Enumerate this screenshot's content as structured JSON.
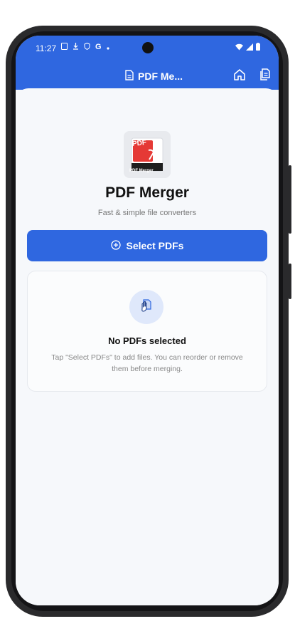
{
  "status": {
    "time": "11:27",
    "left_icons": [
      "sim-icon",
      "download-icon",
      "shield-icon",
      "google-icon",
      "dot-icon"
    ],
    "right_icons": [
      "wifi-icon",
      "signal-icon",
      "battery-icon"
    ]
  },
  "appbar": {
    "title": "PDF Me...",
    "title_icon": "document-icon",
    "actions": [
      "home-icon",
      "files-icon"
    ]
  },
  "hero": {
    "logo_top_text": "PDF",
    "logo_bottom_text": "PDF Merger",
    "app_name": "PDF Merger",
    "tagline": "Fast & simple file converters"
  },
  "select_button": {
    "label": "Select PDFs",
    "icon": "plus-circle-icon"
  },
  "empty_state": {
    "icon": "hand-document-icon",
    "title": "No PDFs selected",
    "description": "Tap \"Select PDFs\" to add files. You can reorder or remove them before merging."
  },
  "colors": {
    "primary": "#2f67e0",
    "background": "#f6f8fb",
    "logo_red": "#e53935"
  }
}
